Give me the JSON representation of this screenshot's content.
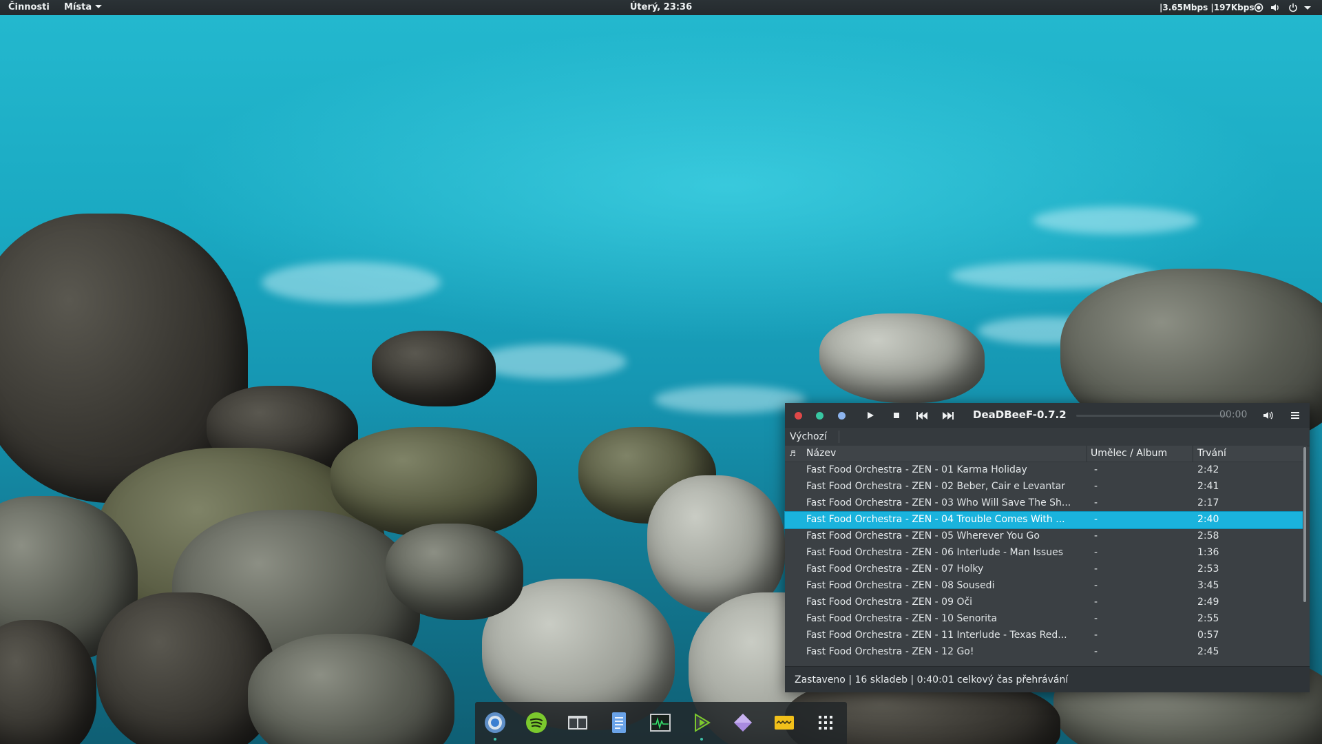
{
  "topbar": {
    "activities": "Činnosti",
    "places": "Místa",
    "clock": "Úterý, 23:36",
    "netspeed": "|3.65Mbps |197Kbps",
    "tray_icons": [
      "network-icon",
      "volume-icon",
      "power-icon"
    ]
  },
  "player": {
    "title": "DeaDBeeF-0.7.2",
    "time": "00:00",
    "window_buttons": {
      "close": "#e04848",
      "minimize": "#38c7a2",
      "maximize": "#8db4ee"
    },
    "accent": "#1ab3dd",
    "tab": "Výchozí",
    "columns": {
      "title": "Název",
      "artist": "Umělec / Album",
      "duration": "Trvání"
    },
    "tracks": [
      {
        "title": "Fast Food Orchestra - ZEN - 01 Karma Holiday",
        "artist": "-",
        "duration": "2:42"
      },
      {
        "title": "Fast Food Orchestra - ZEN - 02 Beber, Cair e Levantar",
        "artist": "-",
        "duration": "2:41"
      },
      {
        "title": "Fast Food Orchestra - ZEN - 03 Who Will Save The Sh...",
        "artist": "-",
        "duration": "2:17"
      },
      {
        "title": "Fast Food Orchestra - ZEN - 04 Trouble Comes With ...",
        "artist": "-",
        "duration": "2:40"
      },
      {
        "title": "Fast Food Orchestra - ZEN - 05 Wherever You Go",
        "artist": "-",
        "duration": "2:58"
      },
      {
        "title": "Fast Food Orchestra - ZEN - 06 Interlude - Man Issues",
        "artist": "-",
        "duration": "1:36"
      },
      {
        "title": "Fast Food Orchestra - ZEN - 07 Holky",
        "artist": "-",
        "duration": "2:53"
      },
      {
        "title": "Fast Food Orchestra - ZEN - 08 Sousedi",
        "artist": "-",
        "duration": "3:45"
      },
      {
        "title": "Fast Food Orchestra - ZEN - 09 Oči",
        "artist": "-",
        "duration": "2:49"
      },
      {
        "title": "Fast Food Orchestra - ZEN - 10 Senorita",
        "artist": "-",
        "duration": "2:55"
      },
      {
        "title": "Fast Food Orchestra - ZEN - 11 Interlude - Texas Red...",
        "artist": "-",
        "duration": "0:57"
      },
      {
        "title": "Fast Food Orchestra - ZEN - 12 Go!",
        "artist": "-",
        "duration": "2:45"
      }
    ],
    "selected_index": 3,
    "status": "Zastaveno | 16 skladeb | 0:40:01 celkový čas přehrávání"
  },
  "dock": {
    "apps": [
      "chromium-icon",
      "spotify-icon",
      "file-manager-icon",
      "text-editor-icon",
      "system-monitor-icon",
      "deadbeef-icon",
      "gem-icon",
      "notes-icon",
      "app-grid-icon"
    ]
  }
}
